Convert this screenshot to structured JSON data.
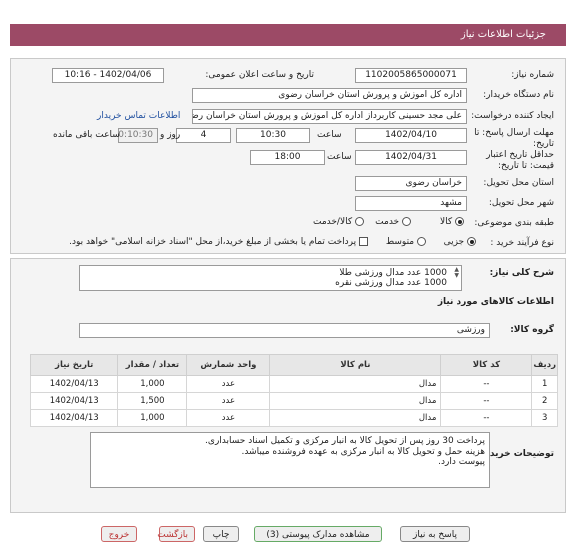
{
  "window": {
    "title": "جزئیات اطلاعات نیاز"
  },
  "fields": {
    "need_number_label": "شماره نیاز:",
    "need_number": "1102005865000071",
    "announce_label": "تاریخ و ساعت اعلان عمومی:",
    "announce_value": "1402/04/06 - 10:16",
    "buyer_org_label": "نام دستگاه خریدار:",
    "buyer_org": "اداره کل اموزش و پرورش استان خراسان رضوی",
    "requester_label": "ایجاد کننده درخواست:",
    "requester": "علی مجد حسینی کاربرداز اداره کل اموزش و پرورش استان خراسان رضوی",
    "buyer_contact_link": "اطلاعات تماس خریدار",
    "send_deadline_label": "مهلت ارسال پاسخ: تا تاریخ:",
    "send_date": "1402/04/10",
    "time_label": "ساعت",
    "send_time": "10:30",
    "days_value": "4",
    "days_label": "روز و",
    "remaining_time": "00:10:30",
    "remaining_label": "ساعت باقی مانده",
    "validity_label": "حداقل تاریخ اعتبار قیمت: تا تاریخ:",
    "validity_date": "1402/04/31",
    "validity_time_label": "ساعت",
    "validity_time": "18:00",
    "province_label": "استان محل تحویل:",
    "province": "خراسان رضوی",
    "city_label": "شهر محل تحویل:",
    "city": "مشهد",
    "category_label": "طبقه بندی موضوعی:",
    "category_options": [
      "کالا",
      "خدمت",
      "کالا/خدمت"
    ],
    "process_label": "نوع فرآیند خرید :",
    "process_options": [
      "جزیی",
      "متوسط"
    ],
    "payment_note": "پرداخت تمام یا بخشی از مبلغ خرید،از محل \"اسناد خزانه اسلامی\" خواهد بود."
  },
  "description": {
    "label": "شرح کلی نیاز:",
    "lines": [
      "1000 عدد مدال ورزشی طلا",
      "1000 عدد مدال ورزشی نقره"
    ]
  },
  "goods_info": {
    "heading": "اطلاعات کالاهای مورد نیاز",
    "group_label": "گروه کالا:",
    "group_value": "ورزشی"
  },
  "table": {
    "headers": [
      "ردیف",
      "کد کالا",
      "نام کالا",
      "واحد شمارش",
      "تعداد / مقدار",
      "تاریخ نیاز"
    ],
    "rows": [
      [
        "1",
        "--",
        "مدال",
        "عدد",
        "1,000",
        "1402/04/13"
      ],
      [
        "2",
        "--",
        "مدال",
        "عدد",
        "1,500",
        "1402/04/13"
      ],
      [
        "3",
        "--",
        "مدال",
        "عدد",
        "1,000",
        "1402/04/13"
      ]
    ]
  },
  "buyer_notes": {
    "label": "توضیحات خریدار:",
    "lines": [
      "پرداخت 30 روز پس از تحویل کالا به انبار مرکزی و تکمیل اسناد حسابداری.",
      "هزینه حمل و تحویل کالا به انبار مرکزی به عهده فروشنده میباشد.",
      "پیوست دارد."
    ]
  },
  "buttons": {
    "reply": "پاسخ به نیاز",
    "attachments": "مشاهده مدارک پیوستی (3)",
    "print": "چاپ",
    "back": "بازگشت",
    "exit": "خروج"
  },
  "colors": {
    "title_bar": "#9c4a66"
  }
}
